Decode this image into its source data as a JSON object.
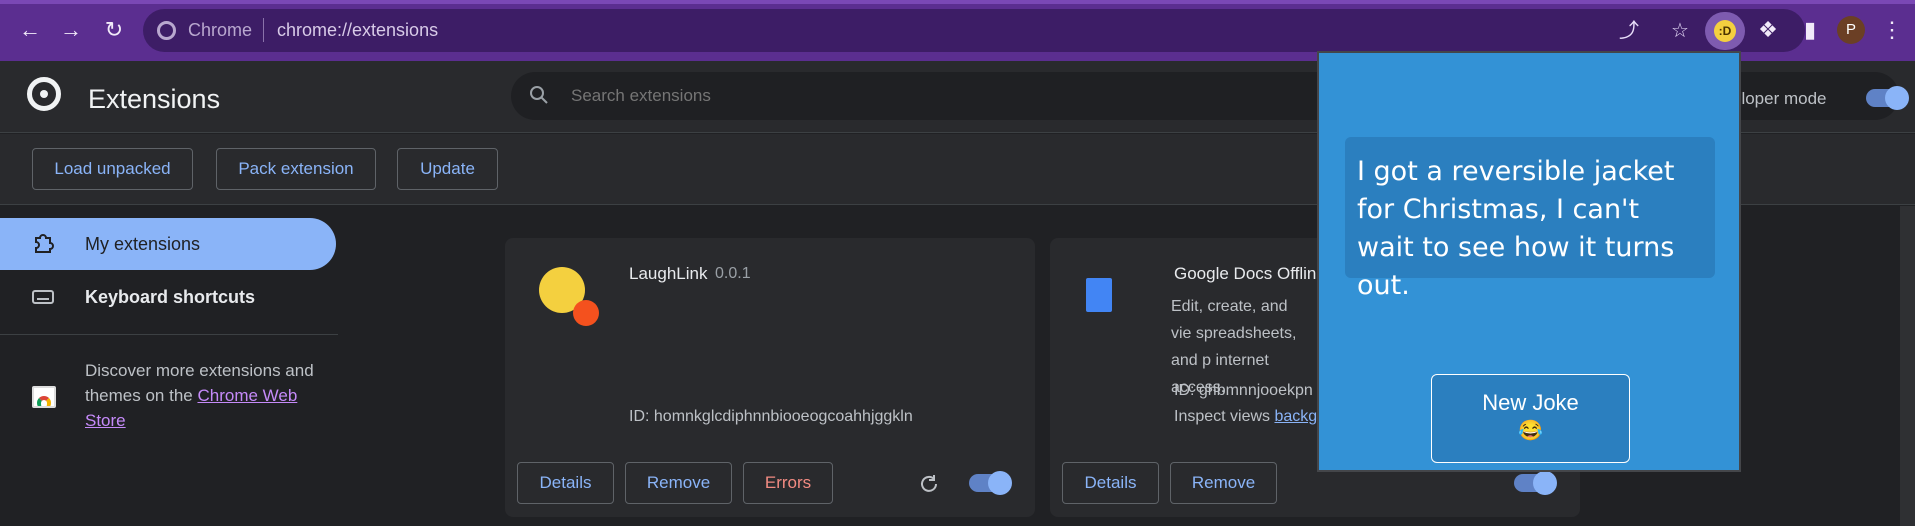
{
  "browser": {
    "back_icon": "arrow-left-icon",
    "forward_icon": "arrow-right-icon",
    "reload_icon": "reload-icon",
    "omnibox_label": "Chrome",
    "url": "chrome://extensions",
    "share_icon": "share-icon",
    "star_icon": "star-icon",
    "extension_icon": "puzzle-icon",
    "sidepanel_icon": "sidepanel-icon",
    "profile_initial": "P",
    "menu_icon": "kebab-icon",
    "theme_color": "#5b2e90"
  },
  "page": {
    "title": "Extensions",
    "search_placeholder": "Search extensions",
    "developer_mode_label": "eloper mode",
    "developer_mode_on": true
  },
  "toolbar": {
    "load_unpacked": "Load unpacked",
    "pack_extension": "Pack extension",
    "update": "Update"
  },
  "sidebar": {
    "items": [
      {
        "label": "My extensions",
        "icon": "extension-icon",
        "active": true
      },
      {
        "label": "Keyboard shortcuts",
        "icon": "keyboard-icon",
        "active": false
      }
    ],
    "discover_prefix": "Discover more extensions and themes on the ",
    "discover_link": "Chrome Web Store"
  },
  "cards": [
    {
      "name": "LaughLink",
      "version": "0.0.1",
      "id": "ID: homnkglcdiphnnbiooeogcoahhjggkln",
      "buttons": [
        "Details",
        "Remove",
        "Errors"
      ],
      "enabled": true
    },
    {
      "name": "Google Docs Offline",
      "visible_name": "Google Docs Offline",
      "description": "Edit, create, and vie spreadsheets, and p internet access.",
      "id": "ID: ghbmnnjooekpn",
      "inspect_prefix": "Inspect views ",
      "inspect_link": "backg",
      "buttons": [
        "Details",
        "Remove"
      ],
      "enabled": true
    }
  ],
  "popup": {
    "joke": "I got a reversible jacket for Christmas, I can't wait to see how it turns out.",
    "button_label": "New Joke",
    "button_emoji": "😂",
    "background": "#3392d6"
  }
}
